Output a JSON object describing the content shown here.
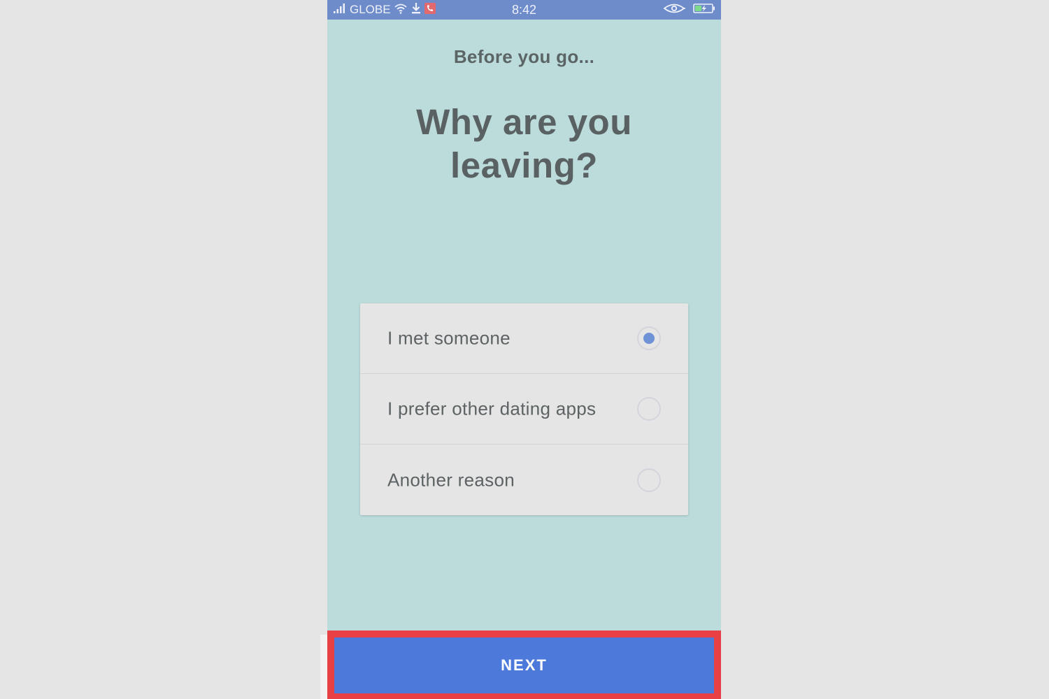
{
  "status_bar": {
    "carrier": "GLOBE",
    "time": "8:42"
  },
  "screen": {
    "pre_title": "Before you go...",
    "title": "Why are you leaving?"
  },
  "options": [
    {
      "label": "I met someone",
      "selected": true
    },
    {
      "label": "I prefer other dating apps",
      "selected": false
    },
    {
      "label": "Another reason",
      "selected": false
    }
  ],
  "next_button": {
    "label": "NEXT"
  },
  "colors": {
    "background": "#bcdcdb",
    "status_bar": "#6e8bca",
    "button": "#4c79da",
    "highlight_border": "#e94046",
    "radio_selected": "#6f92d6"
  }
}
